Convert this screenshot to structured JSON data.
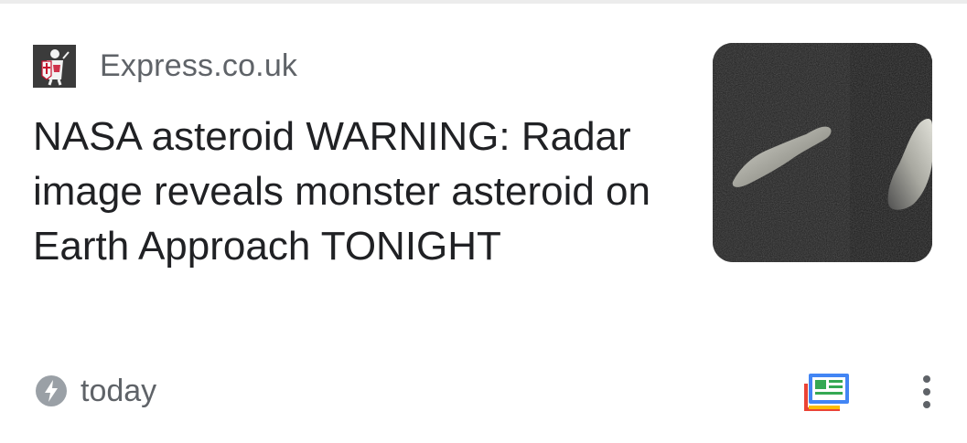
{
  "card": {
    "source": {
      "name": "Express.co.uk",
      "logo_icon": "crusader-knight-logo"
    },
    "headline": "NASA asteroid WARNING: Radar image reveals monster asteroid on Earth Approach TONIGHT",
    "thumbnail_icon": "asteroid-radar-image",
    "meta": {
      "time_icon": "lightning-bolt-icon",
      "time": "today"
    },
    "actions": {
      "news_icon": "google-news-icon",
      "more_icon": "more-vert-icon"
    }
  },
  "colors": {
    "text_primary": "#202124",
    "text_secondary": "#5f6368",
    "news_blue": "#4285f4",
    "news_green": "#34a853",
    "news_yellow": "#fbbc04",
    "news_red": "#ea4335"
  }
}
